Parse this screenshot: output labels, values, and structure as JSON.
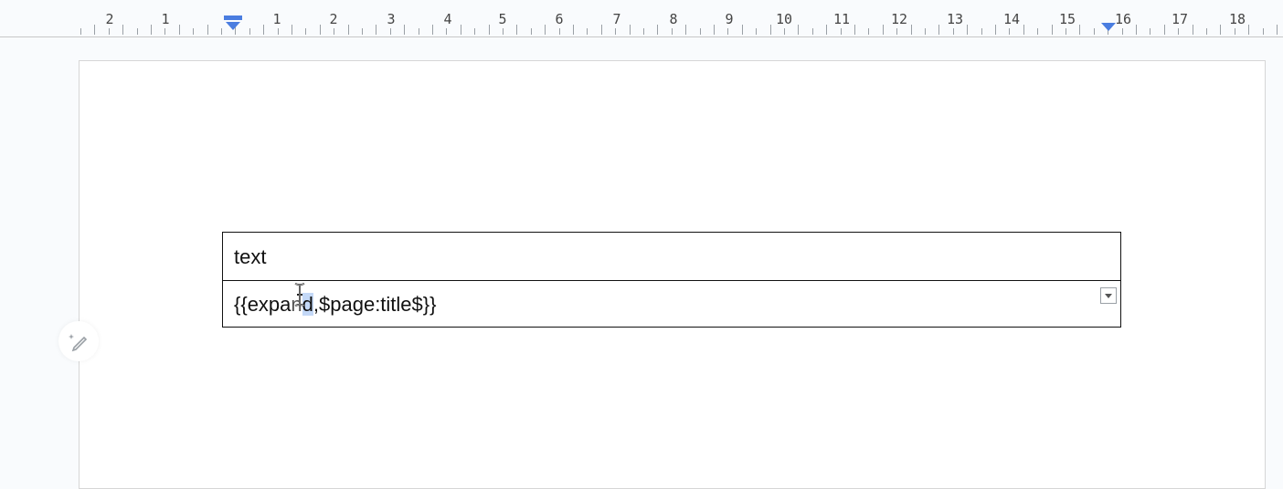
{
  "ruler": {
    "labels": [
      "2",
      "1",
      "1",
      "2",
      "3",
      "4",
      "5",
      "6",
      "7",
      "8",
      "9",
      "10",
      "11",
      "12",
      "13",
      "14",
      "15",
      "16",
      "17",
      "18"
    ]
  },
  "table": {
    "header_text": "text",
    "cell_before": "{{expa",
    "cell_hidden": "n",
    "cell_selected": "d",
    "cell_after": ",$page:title$}}"
  },
  "colors": {
    "accent": "#4a7de0",
    "selection": "#c3d8f7"
  },
  "icons": [
    "indent-marker-icon",
    "edit-assist-icon",
    "dropdown-icon",
    "text-cursor-icon"
  ]
}
